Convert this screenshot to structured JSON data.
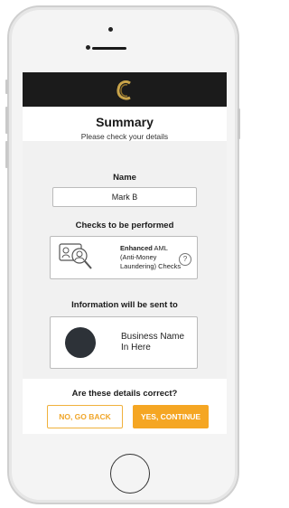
{
  "header": {
    "logo_icon": "letter-c-logo-icon",
    "logo_color": "#c9a44a",
    "bar_color": "#1b1b1b"
  },
  "summary": {
    "title": "Summary",
    "subtitle": "Please check your details"
  },
  "name_section": {
    "label": "Name",
    "value": "Mark B"
  },
  "checks_section": {
    "label": "Checks to be performed",
    "icon": "identity-check-magnifier-icon",
    "bold": "Enhanced",
    "line1_rest": " AML",
    "line2": "(Anti-Money",
    "line3": "Laundering) Checks",
    "help_glyph": "?"
  },
  "info_section": {
    "label": "Information will be sent to",
    "business_line1": "Business Name",
    "business_line2": "In Here"
  },
  "confirm": {
    "question": "Are these details correct?",
    "back_label": "NO, GO BACK",
    "continue_label": "YES, CONTINUE"
  },
  "colors": {
    "accent": "#f5a623",
    "avatar": "#2d3238"
  }
}
